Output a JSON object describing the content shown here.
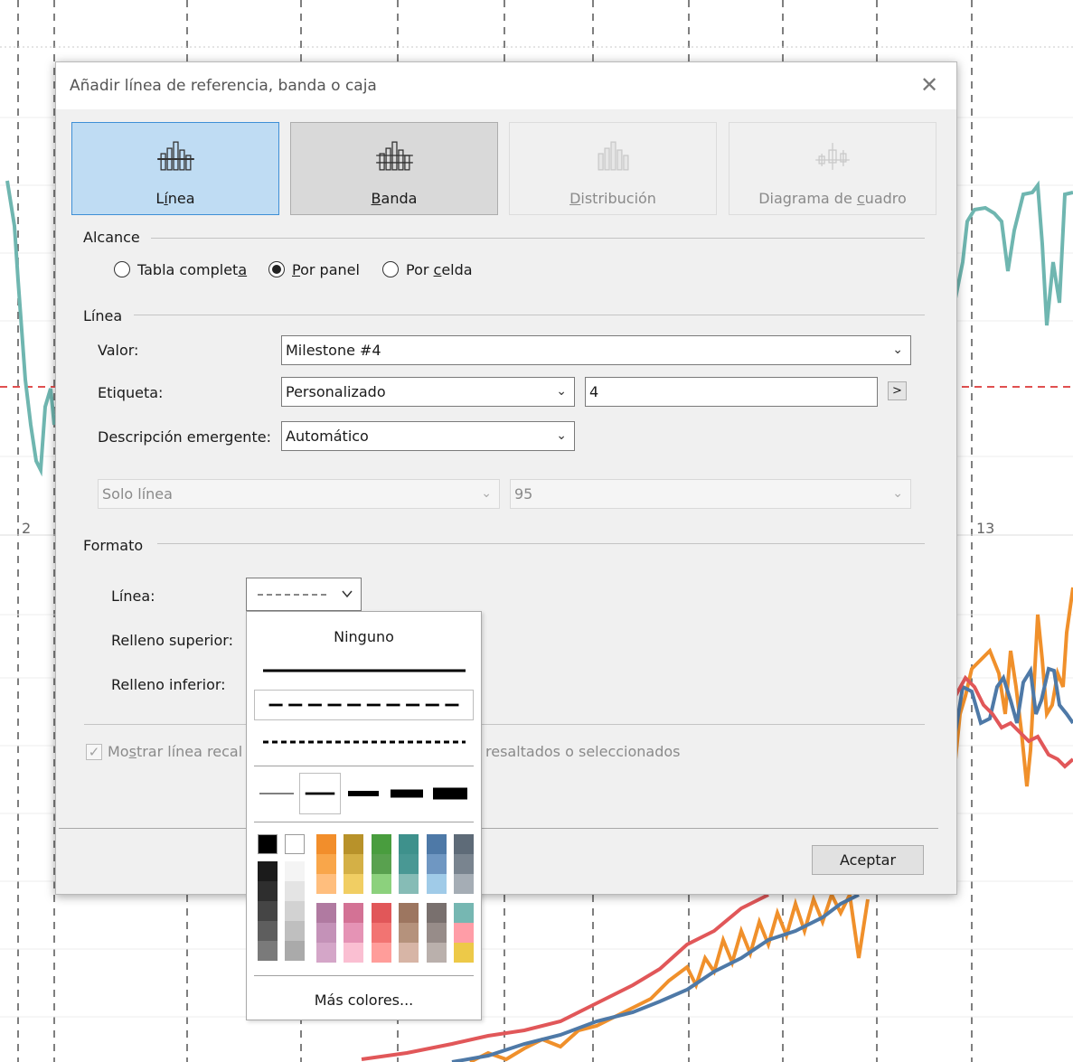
{
  "background": {
    "axis_label_left": "2",
    "axis_label_right": "13"
  },
  "dialog": {
    "title": "Añadir línea de referencia, banda o caja",
    "close_glyph": "✕",
    "types": [
      {
        "pre": "L",
        "acc": "í",
        "post": "nea"
      },
      {
        "pre": "",
        "acc": "B",
        "post": "anda"
      },
      {
        "pre": "",
        "acc": "D",
        "post": "istribución"
      },
      {
        "pre": "Diagrama de ",
        "acc": "c",
        "post": "uadro"
      }
    ],
    "scope": {
      "heading": "Alcance",
      "options": [
        {
          "pre": "Tabla complet",
          "acc": "a",
          "post": ""
        },
        {
          "pre": "",
          "acc": "P",
          "post": "or panel"
        },
        {
          "pre": "Por ",
          "acc": "c",
          "post": "elda"
        }
      ],
      "selected_index": 1
    },
    "line": {
      "heading": "Línea",
      "value_label": "Valor:",
      "value": "Milestone #4",
      "label_label": "Etiqueta:",
      "label_value": "Personalizado",
      "label_text": "4",
      "insert_button": ">",
      "tooltip_label": "Descripción emergente:",
      "tooltip_value": "Automático",
      "line_only_value": "Solo línea",
      "confidence_value": "95"
    },
    "format": {
      "heading": "Formato",
      "line_label": "Línea:",
      "fill_above_label": "Relleno superior:",
      "fill_below_label": "Relleno inferior:"
    },
    "recalc": {
      "checked": true,
      "pre": "Mo",
      "acc": "s",
      "post": "trar línea recal",
      "tail": "resaltados o seleccionados"
    },
    "ok_button": "Aceptar"
  },
  "line_popup": {
    "none_label": "Ninguno",
    "more_colors_label": "Más colores...",
    "palette_top": [
      "#000000",
      "#ffffff"
    ],
    "gray_dark": [
      "#1b1b1b",
      "#2e2e2e",
      "#454545",
      "#5e5e5e",
      "#7a7a7a"
    ],
    "gray_light": [
      "#f4f4f4",
      "#e4e4e4",
      "#d2d2d2",
      "#bfbfbf",
      "#aaaaaa"
    ],
    "color_columns_top": [
      [
        "#f28e2b",
        "#f9a64a",
        "#ffbe7d"
      ],
      [
        "#b8922a",
        "#d4b046",
        "#f1ce63"
      ],
      [
        "#499d3e",
        "#59a14f",
        "#8cd17d"
      ],
      [
        "#3e918c",
        "#499894",
        "#86bcb6"
      ],
      [
        "#4e79a7",
        "#6f97c2",
        "#a0cbe8"
      ],
      [
        "#5e6b78",
        "#79848f",
        "#a5adb5"
      ]
    ],
    "color_columns_bottom": [
      [
        "#b07aa1",
        "#c492b8",
        "#d4a6c8"
      ],
      [
        "#d37295",
        "#e593b5",
        "#fabfd2"
      ],
      [
        "#e15759",
        "#f27472",
        "#ff9d9a"
      ],
      [
        "#9d7660",
        "#b5927c",
        "#d7b5a6"
      ],
      [
        "#79706e",
        "#978c89",
        "#bab0ac"
      ],
      [
        "#76b7b2",
        "#ff9da7",
        "#edc948"
      ]
    ]
  }
}
